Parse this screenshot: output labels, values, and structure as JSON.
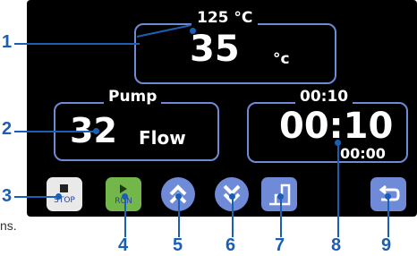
{
  "temp_panel": {
    "setpoint": "125 °C",
    "value": "35",
    "unit": "°c"
  },
  "pump_panel": {
    "title": "Pump",
    "value": "32",
    "mode": "Flow"
  },
  "timer_panel": {
    "setpoint": "00:10",
    "value": "00:10",
    "sub": "00:00"
  },
  "buttons": {
    "stop": {
      "label": "STOP"
    },
    "run": {
      "label": "RUN"
    }
  },
  "callouts": [
    "1",
    "2",
    "3",
    "4",
    "5",
    "6",
    "7",
    "8",
    "9"
  ],
  "side_text": "ns."
}
